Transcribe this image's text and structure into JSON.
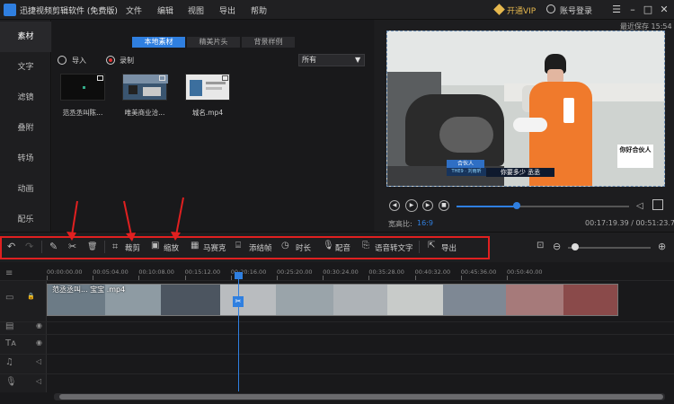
{
  "app": {
    "title": "迅捷视频剪辑软件 (免费版)"
  },
  "menu": [
    "文件",
    "编辑",
    "视图",
    "导出",
    "帮助"
  ],
  "header": {
    "vip_label": "开通VIP",
    "login_label": "账号登录",
    "save_time": "最近保存 15:54"
  },
  "sidebar": {
    "items": [
      {
        "label": "素材",
        "active": true
      },
      {
        "label": "文字"
      },
      {
        "label": "滤镜"
      },
      {
        "label": "叠附"
      },
      {
        "label": "转场"
      },
      {
        "label": "动画"
      },
      {
        "label": "配乐"
      }
    ]
  },
  "library": {
    "tabs": [
      {
        "label": "本地素材",
        "active": true
      },
      {
        "label": "精美片头"
      },
      {
        "label": "背景样例"
      }
    ],
    "import_label": "导入",
    "record_label": "录制",
    "filter_value": "所有",
    "items": [
      {
        "label": "范丞丞叫陈..."
      },
      {
        "label": "唯美商业洽..."
      },
      {
        "label": "城名.mp4"
      }
    ]
  },
  "preview": {
    "subtitle_name": "合伙人",
    "subtitle_line": "你要多少  丞丞",
    "show_badge": "THE9 · 刘雨昕",
    "logo_text": "你好合伙人",
    "aspect_label": "宽高比:",
    "aspect_value": "16:9",
    "time_current": "00:17:19.39",
    "time_total": "00:51:23.78",
    "progress": 0.35
  },
  "toolbar": {
    "crop": "裁剪",
    "zoom": "缩放",
    "mosaic": "马赛克",
    "freeze": "添结帧",
    "duration": "时长",
    "dub": "配音",
    "speech_to_text": "语音转文字",
    "export": "导出"
  },
  "timeline": {
    "ticks": [
      "00:00:00.00",
      "00:05:04.00",
      "00:10:08.00",
      "00:15:12.00",
      "00:20:16.00",
      "00:25:20.00",
      "00:30:24.00",
      "00:35:28.00",
      "00:40:32.00",
      "00:45:36.00",
      "00:50:40.00"
    ],
    "clip_label": "范丞丞叫... 宝宝 .mp4"
  },
  "colors": {
    "accent": "#2f7fe0",
    "highlight": "#e02020",
    "vip": "#e6b84e"
  }
}
